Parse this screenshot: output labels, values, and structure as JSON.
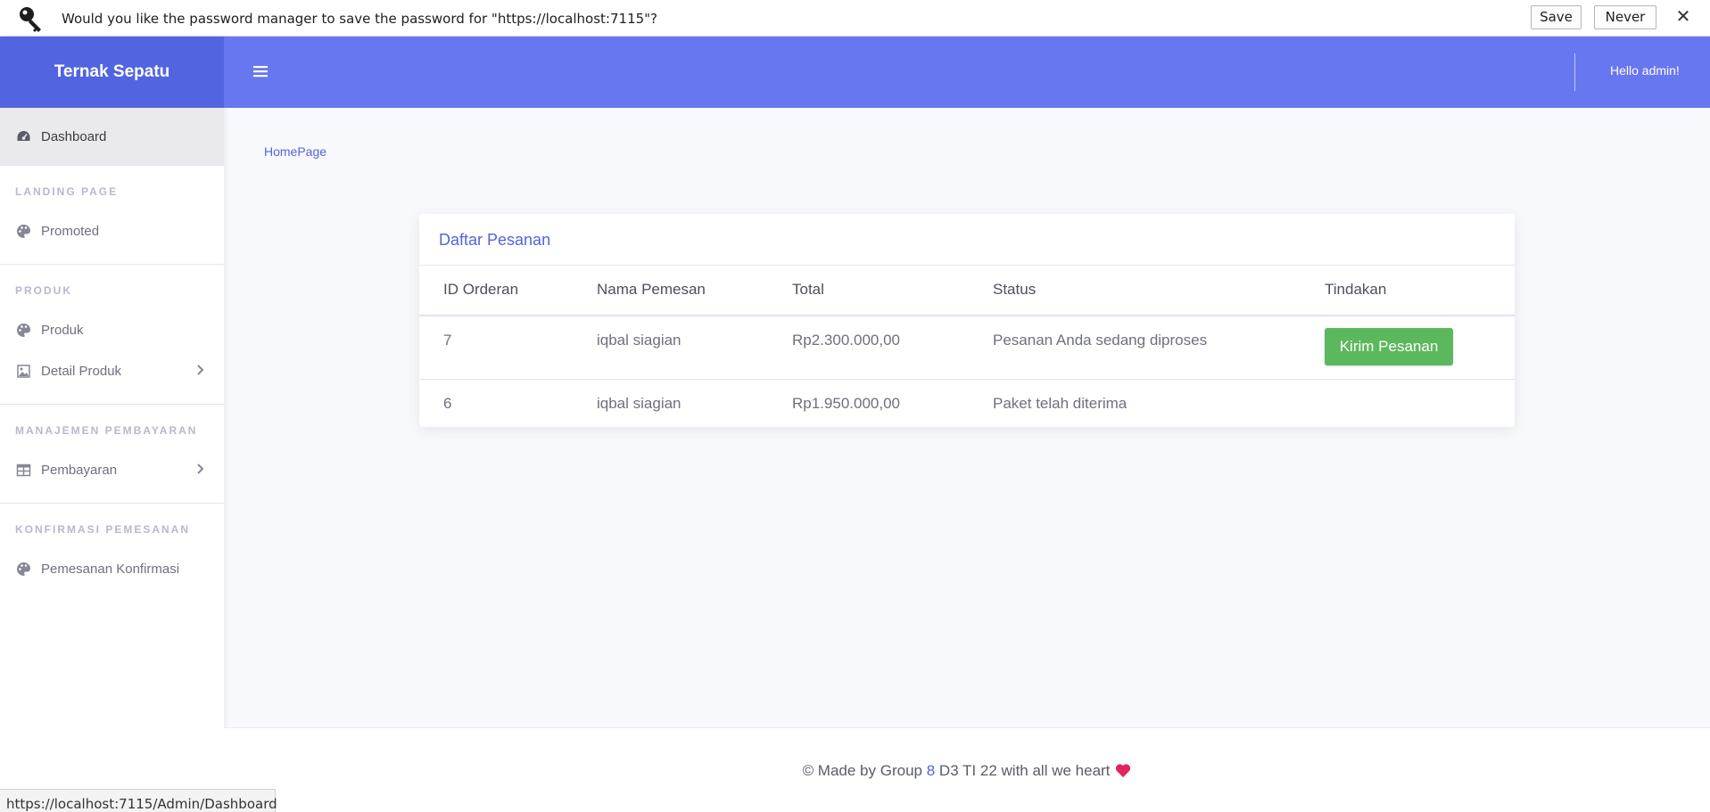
{
  "password_bar": {
    "message": "Would you like the password manager to save the password for \"https://localhost:7115\"?",
    "save_label": "Save",
    "never_label": "Never",
    "close_label": "✕"
  },
  "sidebar": {
    "brand": "Ternak Sepatu",
    "dashboard_label": "Dashboard",
    "sections": [
      {
        "heading": "LANDING PAGE",
        "items": [
          {
            "label": "Promoted",
            "icon": "palette-icon"
          }
        ]
      },
      {
        "heading": "PRODUK",
        "items": [
          {
            "label": "Produk",
            "icon": "palette-icon"
          },
          {
            "label": "Detail Produk",
            "icon": "image-icon",
            "has_chevron": true
          }
        ]
      },
      {
        "heading": "MANAJEMEN PEMBAYARAN",
        "items": [
          {
            "label": "Pembayaran",
            "icon": "table-icon",
            "has_chevron": true
          }
        ]
      },
      {
        "heading": "KONFIRMASI PEMESANAN",
        "items": [
          {
            "label": "Pemesanan Konfirmasi",
            "icon": "palette-icon"
          }
        ]
      }
    ]
  },
  "topbar": {
    "greeting": "Hello admin!"
  },
  "breadcrumb": "HomePage",
  "orders_card": {
    "title": "Daftar Pesanan",
    "columns": [
      "ID Orderan",
      "Nama Pemesan",
      "Total",
      "Status",
      "Tindakan"
    ],
    "rows": [
      {
        "id": "7",
        "name": "iqbal siagian",
        "total": "Rp2.300.000,00",
        "status": "Pesanan Anda sedang diproses",
        "action": "Kirim Pesanan"
      },
      {
        "id": "6",
        "name": "iqbal siagian",
        "total": "Rp1.950.000,00",
        "status": "Paket telah diterima",
        "action": ""
      }
    ]
  },
  "footer": {
    "prefix": "© Made by Group ",
    "group_number": "8",
    "suffix": " D3 TI 22 with all we heart"
  },
  "status_url": "https://localhost:7115/Admin/Dashboard",
  "colors": {
    "brand": "#5264df",
    "topbar": "#6777ef",
    "success": "#5cb85c",
    "heart": "#e0245e"
  }
}
